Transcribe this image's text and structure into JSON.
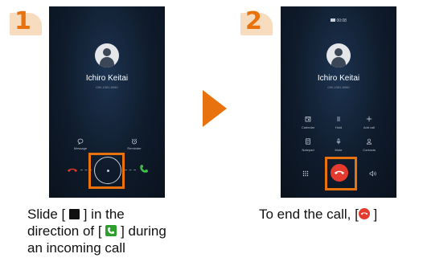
{
  "step1": {
    "number": "1",
    "caller_name": "Ichiro Keitai",
    "caller_number": "090-1081-8080",
    "message_label": "Message",
    "reminder_label": "Reminder",
    "caption_line1": "Slide [",
    "caption_line1b": "] in the",
    "caption_line2": "direction of [",
    "caption_line2b": "] during",
    "caption_line3": "an incoming call"
  },
  "step2": {
    "number": "2",
    "status_time": "00:08",
    "caller_name": "Ichiro Keitai",
    "caller_number": "090-1081-8080",
    "buttons": [
      {
        "label": "Calendar",
        "icon": "calendar-icon"
      },
      {
        "label": "Hold",
        "icon": "pause-icon"
      },
      {
        "label": "Add call",
        "icon": "plus-icon"
      },
      {
        "label": "Notepad",
        "icon": "notepad-icon"
      },
      {
        "label": "Mute",
        "icon": "mic-icon"
      },
      {
        "label": "Contacts",
        "icon": "contacts-icon"
      }
    ],
    "caption_before": "To end the call, [",
    "caption_after": "]"
  },
  "colors": {
    "accent_orange": "#e8730e",
    "answer_green": "#2e9e2e",
    "end_red": "#e53a2e"
  }
}
